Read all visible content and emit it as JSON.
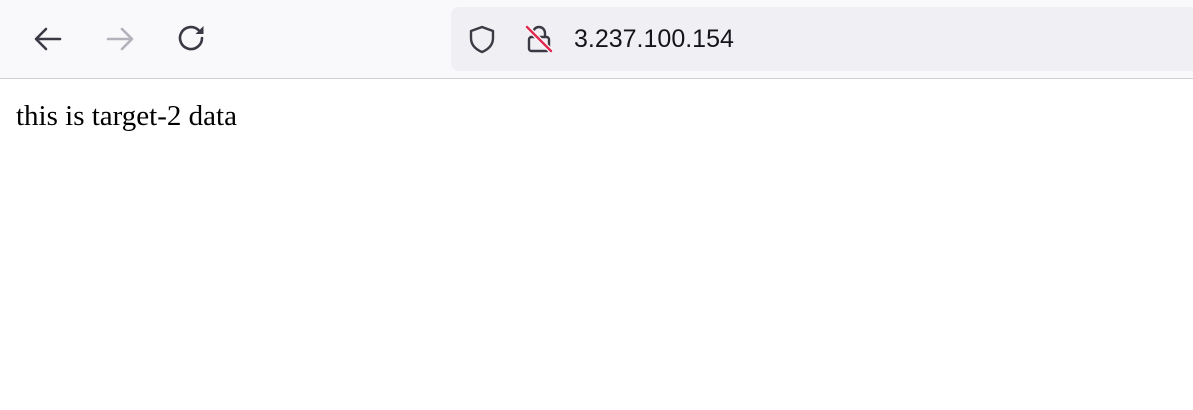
{
  "browser": {
    "toolbar": {
      "back_icon": "arrow-left-icon",
      "forward_icon": "arrow-right-icon",
      "reload_icon": "reload-icon",
      "forward_enabled": false
    },
    "address_bar": {
      "tracking_protection_icon": "shield-icon",
      "connection_icon": "insecure-lock-icon",
      "url": "3.237.100.154"
    }
  },
  "page": {
    "body_text": "this is target-2 data"
  },
  "colors": {
    "toolbar_bg": "#f9f9fb",
    "urlbar_bg": "#f0f0f4",
    "icon_active": "#5b5b66",
    "icon_disabled": "#b3b3bb",
    "insecure_accent": "#e22850",
    "text": "#15141a"
  }
}
